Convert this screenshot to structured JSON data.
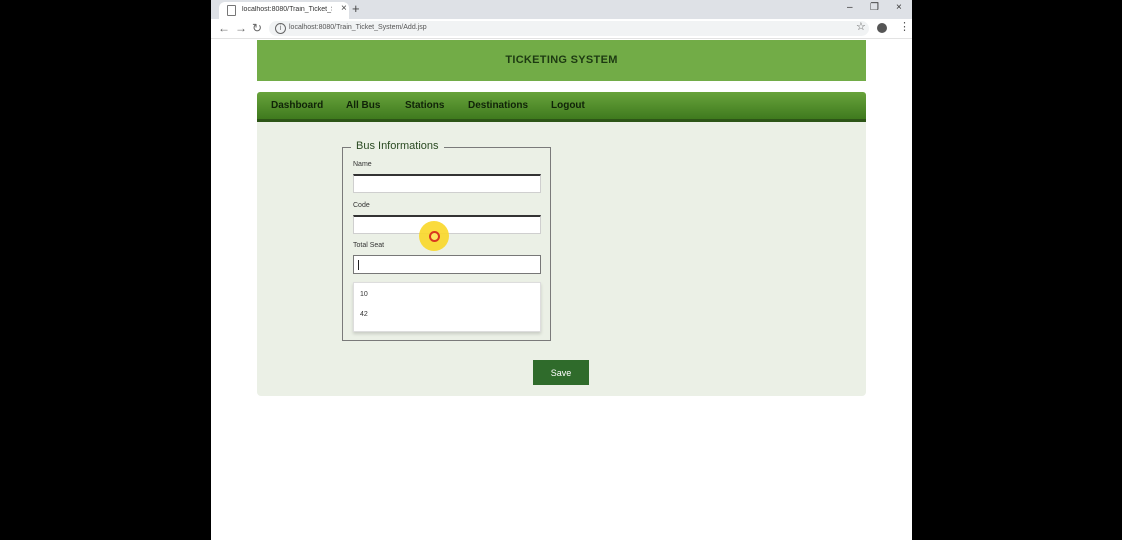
{
  "browser": {
    "tab_title": "localhost:8080/Train_Ticket_System/",
    "tab_close": "×",
    "new_tab": "+",
    "win_minimize": "–",
    "win_restore": "❐",
    "win_close": "×",
    "back": "←",
    "forward": "→",
    "reload": "↻",
    "url": "localhost:8080/Train_Ticket_System/Add.jsp",
    "info_glyph": "i",
    "star": "☆",
    "menu": "⋮"
  },
  "header": {
    "title": "TICKETING SYSTEM"
  },
  "nav": {
    "items": [
      {
        "label": "Dashboard"
      },
      {
        "label": "All Bus"
      },
      {
        "label": "Stations"
      },
      {
        "label": "Destinations"
      },
      {
        "label": "Logout"
      }
    ]
  },
  "form": {
    "legend": "Bus Informations",
    "fields": {
      "name": {
        "label": "Name",
        "value": ""
      },
      "code": {
        "label": "Code",
        "value": ""
      },
      "total_seat": {
        "label": "Total Seat",
        "value": ""
      }
    },
    "autocomplete_options": [
      "10",
      "42"
    ],
    "save_label": "Save"
  },
  "colors": {
    "header_green": "#72ac47",
    "nav_green": "#4f8a2b",
    "save_button": "#2f6b2b",
    "content_bg": "#ebf0e6"
  }
}
